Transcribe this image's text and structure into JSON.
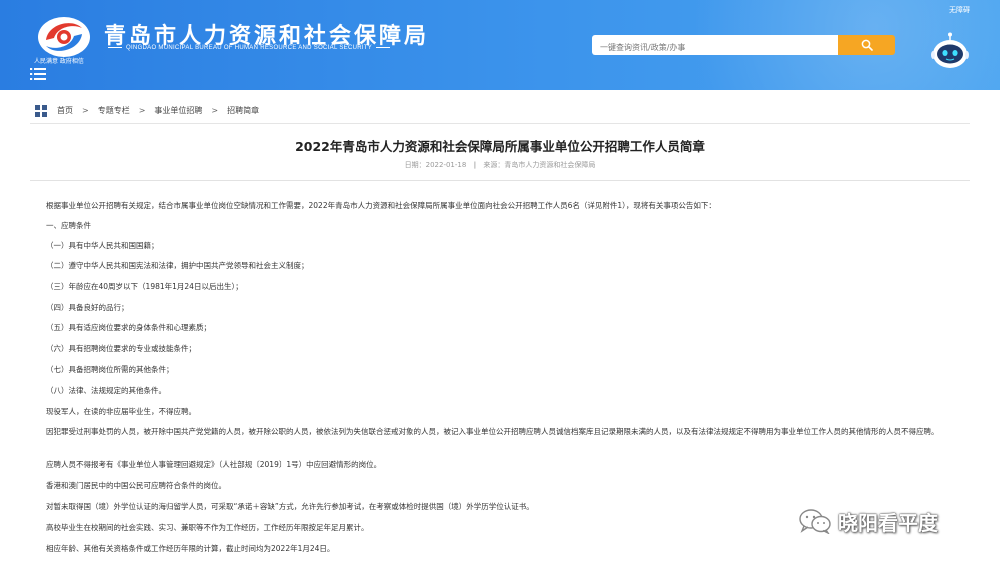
{
  "header": {
    "logo_slogan": "人民满意 政府相信",
    "title": "青岛市人力资源和社会保障局",
    "subtitle": "QINGDAO MUNICIPAL BUREAU OF HUMAN RESOURCE AND SOCIAL SECURITY",
    "accessibility_link": "无障碍",
    "search": {
      "placeholder": "一键查询资讯/政策/办事",
      "value": ""
    },
    "colors": {
      "bar": "#3287e6",
      "search_button": "#f6a623"
    }
  },
  "breadcrumb": {
    "items": [
      "首页",
      "专题专栏",
      "事业单位招聘",
      "招聘简章"
    ],
    "separator": ">"
  },
  "article": {
    "title": "2022年青岛市人力资源和社会保障局所属事业单位公开招聘工作人员简章",
    "date": "日期：2022-01-18",
    "source": "来源：青岛市人力资源和社会保障局",
    "paragraphs": [
      "根据事业单位公开招聘有关规定，结合市属事业单位岗位空缺情况和工作需要，2022年青岛市人力资源和社会保障局所属事业单位面向社会公开招聘工作人员6名（详见附件1），现将有关事项公告如下：",
      "一、应聘条件",
      "（一）具有中华人民共和国国籍；",
      "（二）遵守中华人民共和国宪法和法律，拥护中国共产党领导和社会主义制度；",
      "（三）年龄应在40周岁以下（1981年1月24日以后出生）；",
      "（四）具备良好的品行；",
      "（五）具有适应岗位要求的身体条件和心理素质；",
      "（六）具有招聘岗位要求的专业或技能条件；",
      "（七）具备招聘岗位所需的其他条件；",
      "（八）法律、法规规定的其他条件。",
      "现役军人，在读的非应届毕业生，不得应聘。",
      "因犯罪受过刑事处罚的人员，被开除中国共产党党籍的人员，被开除公职的人员，被依法列为失信联合惩戒对象的人员，被记入事业单位公开招聘应聘人员诚信档案库且记录期限未满的人员，以及有法律法规规定不得聘用为事业单位工作人员的其他情形的人员不得应聘。",
      "应聘人员不得报考有《事业单位人事管理回避规定》（人社部规〔2019〕1号）中应回避情形的岗位。",
      "香港和澳门居民中的中国公民可应聘符合条件的岗位。",
      "对暂未取得国（境）外学位认证的海归留学人员，可采取“承诺＋容缺”方式，允许先行参加考试，在考察或体检时提供国（境）外学历学位认证书。",
      "高校毕业生在校期间的社会实践、实习、兼职等不作为工作经历，工作经历年限按足年足月累计。",
      "相应年龄、其他有关资格条件或工作经历年限的计算，截止时间均为2022年1月24日。"
    ]
  },
  "watermark": {
    "text": "晓阳看平度"
  }
}
